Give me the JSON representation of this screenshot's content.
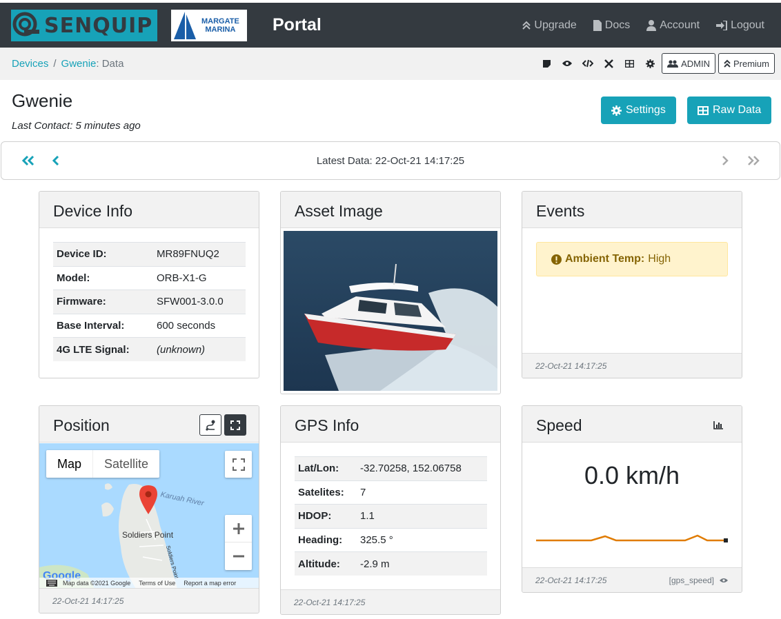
{
  "brand": {
    "senquip_name": "SENQUIP",
    "partner_name_line1": "MARGATE",
    "partner_name_line2": "MARINA",
    "portal_title": "Portal"
  },
  "nav": {
    "upgrade": "Upgrade",
    "docs": "Docs",
    "account": "Account",
    "logout": "Logout"
  },
  "breadcrumb": {
    "devices": "Devices",
    "sep": "/",
    "device": "Gwenie",
    "page": ": Data"
  },
  "toolbar": {
    "admin": "ADMIN",
    "premium": "Premium"
  },
  "header": {
    "title": "Gwenie",
    "last_contact": "Last Contact: 5 minutes ago",
    "settings": "Settings",
    "raw_data": "Raw Data"
  },
  "data_nav": {
    "latest": "Latest Data: 22-Oct-21 14:17:25"
  },
  "device_info": {
    "title": "Device Info",
    "rows": [
      {
        "k": "Device ID:",
        "v": "MR89FNUQ2"
      },
      {
        "k": "Model:",
        "v": "ORB-X1-G"
      },
      {
        "k": "Firmware:",
        "v": "SFW001-3.0.0"
      },
      {
        "k": "Base Interval:",
        "v": "600 seconds"
      },
      {
        "k": "4G LTE Signal:",
        "v": "(unknown)"
      }
    ]
  },
  "asset_image": {
    "title": "Asset Image"
  },
  "events": {
    "title": "Events",
    "alert_label": "Ambient Temp:",
    "alert_value": "High",
    "footer": "22-Oct-21 14:17:25"
  },
  "position": {
    "title": "Position",
    "map_tab": "Map",
    "satellite_tab": "Satellite",
    "place_label": "Soldiers Point",
    "river_label": "Karuah River",
    "road_label": "Soldiers Point",
    "attribution": "Map data ©2021 Google",
    "terms": "Terms of Use",
    "report": "Report a map error",
    "google": "Google",
    "footer": "22-Oct-21 14:17:25"
  },
  "gps_info": {
    "title": "GPS Info",
    "rows": [
      {
        "k": "Lat/Lon:",
        "v": "-32.70258, 152.06758"
      },
      {
        "k": "Satelites:",
        "v": "7"
      },
      {
        "k": "HDOP:",
        "v": "1.1"
      },
      {
        "k": "Heading:",
        "v": "325.5 °"
      },
      {
        "k": "Altitude:",
        "v": "-2.9 m"
      }
    ],
    "footer": "22-Oct-21 14:17:25"
  },
  "speed": {
    "title": "Speed",
    "value": "0.0 km/h",
    "footer": "22-Oct-21 14:17:25",
    "tag": "[gps_speed]",
    "sparkline_color": "#e07b00"
  },
  "colors": {
    "accent": "#17a2b8",
    "navbar": "#343a40"
  }
}
